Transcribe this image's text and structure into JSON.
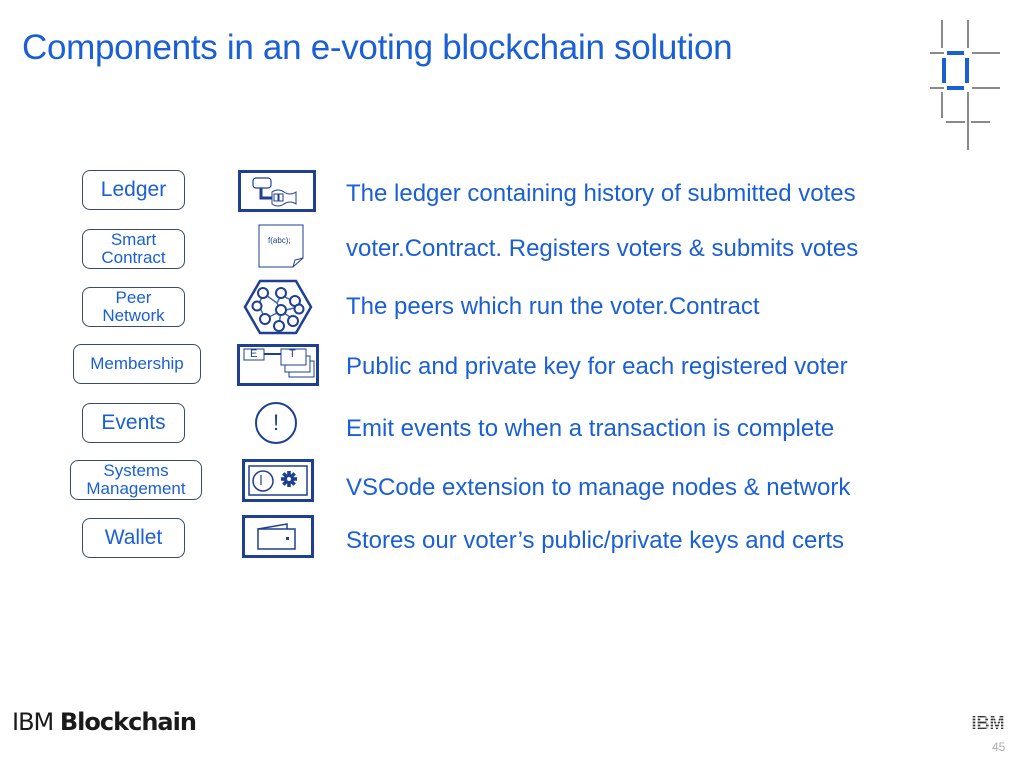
{
  "slide": {
    "title": "Components in an e-voting blockchain solution",
    "rows": [
      {
        "label": "Ledger",
        "icon": "ledger-icon",
        "description": "The ledger containing  history of submitted votes"
      },
      {
        "label": "Smart Contract",
        "icon": "smart-contract-icon",
        "icon_text": "f(abc);",
        "description": "voter.Contract. Registers voters & submits votes"
      },
      {
        "label": "Peer Network",
        "icon": "peer-network-icon",
        "description": "The peers which run the voter.Contract"
      },
      {
        "label": "Membership",
        "icon": "membership-icon",
        "icon_text_e": "E",
        "icon_text_t": "T",
        "description": "Public and private key for each registered voter"
      },
      {
        "label": "Events",
        "icon": "events-icon",
        "icon_text": "!",
        "description": "Emit events to when a transaction is complete"
      },
      {
        "label": "Systems Management",
        "icon": "systems-management-icon",
        "description": "VSCode extension to manage nodes & network"
      },
      {
        "label": "Wallet",
        "icon": "wallet-icon",
        "description": "Stores our voter’s public/private keys and certs"
      }
    ]
  },
  "footer": {
    "brand_light": "IBM ",
    "brand_bold": "Blockchain",
    "logo": "IBM",
    "page_number": "45"
  },
  "colors": {
    "accent_blue": "#1a5fd6",
    "icon_navy": "#1e3f93",
    "decor_gray": "#8a8a8a"
  }
}
